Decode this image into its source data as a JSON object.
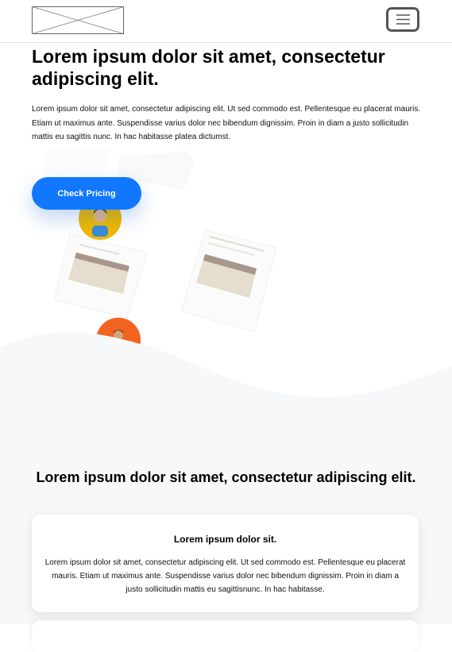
{
  "header": {
    "logo_icon": "image-placeholder-icon",
    "menu_icon": "hamburger-menu-icon"
  },
  "hero": {
    "title": "Lorem ipsum dolor sit amet, consectetur adipiscing elit.",
    "text": "Lorem ipsum dolor sit amet, consectetur adipiscing elit. Ut sed commodo est. Pellentesque eu placerat mauris. Etiam ut maximus ante. Suspendisse varius dolor nec bibendum dignissim. Proin in diam a justo sollicitudin mattis eu sagittis nunc. In hac habitasse platea dictumst.",
    "cta_label": "Check Pricing",
    "accent_color": "#1177ff"
  },
  "features": {
    "title": "Lorem ipsum dolor sit amet, consectetur adipiscing elit.",
    "cards": [
      {
        "title": "Lorem ipsum dolor sit.",
        "text": "Lorem ipsum dolor sit amet, consectetur adipiscing elit. Ut sed commodo est. Pellentesque eu placerat mauris. Etiam ut maximus ante. Suspendisse varius dolor nec bibendum dignissim. Proin in diam a justo sollicitudin mattis eu sagittisnunc. In hac habitasse."
      }
    ]
  }
}
